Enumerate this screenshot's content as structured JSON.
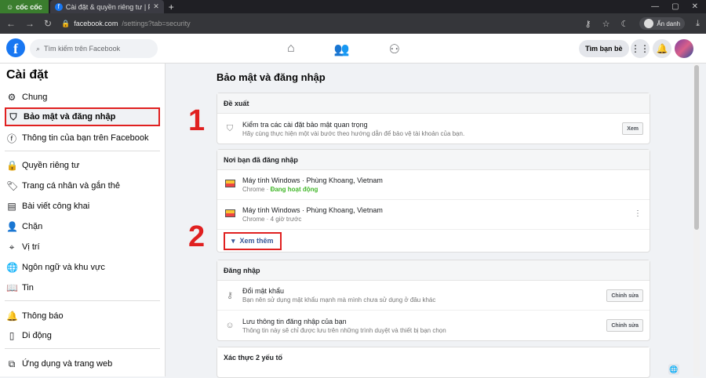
{
  "browser": {
    "brand": "cốc cốc",
    "tab_title": "Cài đặt & quyền riêng tư | Fac",
    "url_host": "facebook.com",
    "url_path": "/settings?tab=security",
    "incognito_label": "Ẩn danh"
  },
  "fb": {
    "search_placeholder": "Tìm kiếm trên Facebook",
    "find_friends": "Tìm bạn bè"
  },
  "sidebar": {
    "title": "Cài đặt",
    "items": [
      {
        "label": "Chung"
      },
      {
        "label": "Bảo mật và đăng nhập"
      },
      {
        "label": "Thông tin của bạn trên Facebook"
      },
      {
        "label": "Quyền riêng tư"
      },
      {
        "label": "Trang cá nhân và gắn thẻ"
      },
      {
        "label": "Bài viết công khai"
      },
      {
        "label": "Chặn"
      },
      {
        "label": "Vị trí"
      },
      {
        "label": "Ngôn ngữ và khu vực"
      },
      {
        "label": "Tin"
      },
      {
        "label": "Thông báo"
      },
      {
        "label": "Di động"
      },
      {
        "label": "Ứng dụng và trang web"
      }
    ]
  },
  "main": {
    "title": "Bảo mật và đăng nhập",
    "suggest": {
      "header": "Đề xuất",
      "title": "Kiểm tra các cài đặt bảo mật quan trọng",
      "desc": "Hãy cùng thực hiện một vài bước theo hướng dẫn để bảo vệ tài khoản của bạn.",
      "button": "Xem"
    },
    "where": {
      "header": "Nơi bạn đã đăng nhập",
      "sessions": [
        {
          "device": "Máy tính Windows · Phùng Khoang, Vietnam",
          "browser": "Chrome · ",
          "status": "Đang hoạt động"
        },
        {
          "device": "Máy tính Windows · Phùng Khoang, Vietnam",
          "browser": "Chrome · 4 giờ trước",
          "status": ""
        }
      ],
      "see_more": "Xem thêm"
    },
    "login": {
      "header": "Đăng nhập",
      "items": [
        {
          "title": "Đổi mật khẩu",
          "desc": "Bạn nên sử dụng mật khẩu mạnh mà mình chưa sử dụng ở đâu khác",
          "button": "Chỉnh sửa"
        },
        {
          "title": "Lưu thông tin đăng nhập của bạn",
          "desc": "Thông tin này sẽ chỉ được lưu trên những trình duyệt và thiết bị bạn chọn",
          "button": "Chỉnh sửa"
        }
      ]
    },
    "twofa": {
      "header": "Xác thực 2 yếu tố"
    }
  },
  "annotations": {
    "one": "1",
    "two": "2"
  },
  "colors": {
    "accent": "#1877f2",
    "annotation": "#e02020",
    "active_green": "#42b72a"
  }
}
